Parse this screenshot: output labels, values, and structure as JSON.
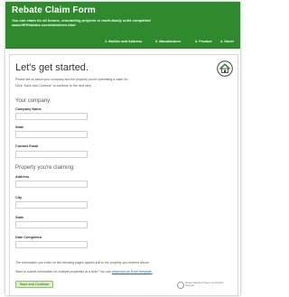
{
  "header": {
    "title": "Rebate Claim Form",
    "subtitle": "You can claim for all homes, remodeling projects or multi-family units completed www.HERebates.com/claimform.html",
    "steps": [
      {
        "label": "1. Builder and Address"
      },
      {
        "label": "2. Manufacturer"
      },
      {
        "label": "3. Product"
      },
      {
        "label": "4. Done!"
      }
    ],
    "color": "#2e8a2c"
  },
  "main": {
    "heading": "Let's get started.",
    "logo_icon": "house-icon",
    "intro_1": "Please tell us about your company and the property you're submitting a claim for.",
    "intro_2": "Click \"Save and Continue\" to continue to the next step.",
    "company_section": "Your company:",
    "property_section": "Property you're claiming:",
    "fields": {
      "company_name": {
        "label": "Company Name",
        "value": ""
      },
      "state_company": {
        "label": "State",
        "value": ""
      },
      "contact_email": {
        "label": "Contact Email",
        "value": ""
      },
      "address": {
        "label": "Address",
        "value": ""
      },
      "city": {
        "label": "City",
        "value": ""
      },
      "state_property": {
        "label": "State",
        "value": ""
      },
      "date_completed": {
        "label": "Date Completed",
        "value": ""
      }
    },
    "submit_label": "Save and Continue",
    "note_1": "The information you enter on the following pages applies just to the property you entered above.",
    "note_2_prefix": "Want to submit information for multiple properties at a time? You can ",
    "note_2_link": "download an Excel template."
  },
  "footer": {
    "seal_text": "Review Rebate Program (c) All rights reserved"
  }
}
